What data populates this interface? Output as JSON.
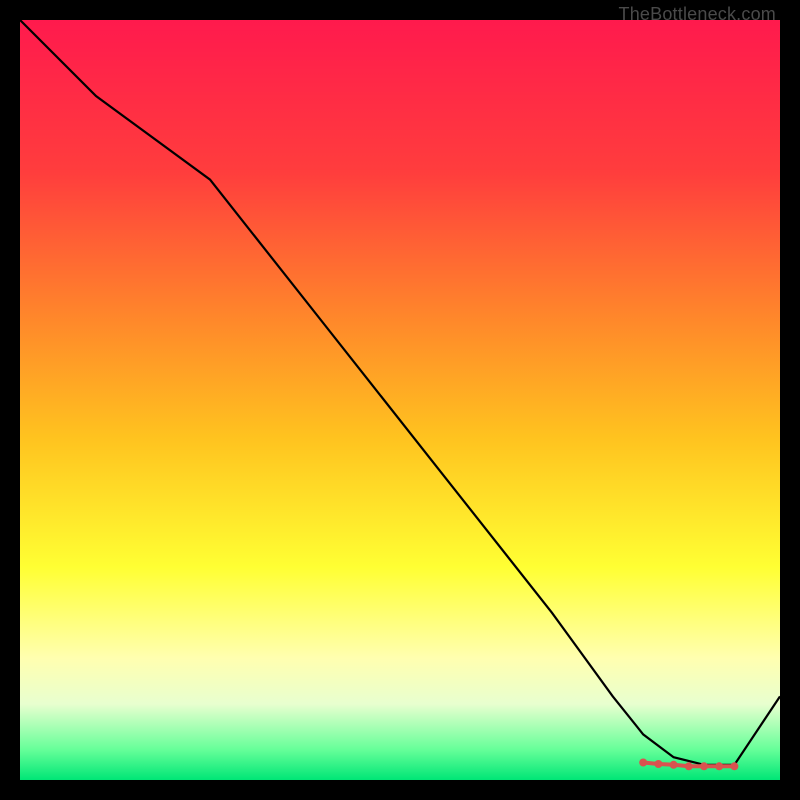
{
  "attribution": "TheBottleneck.com",
  "chart_data": {
    "type": "line",
    "title": "",
    "xlabel": "",
    "ylabel": "",
    "xlim": [
      0,
      100
    ],
    "ylim": [
      0,
      100
    ],
    "gradient_stops": [
      {
        "offset": 0.0,
        "color": "#ff1a4d"
      },
      {
        "offset": 0.2,
        "color": "#ff3d3d"
      },
      {
        "offset": 0.4,
        "color": "#ff8a2a"
      },
      {
        "offset": 0.55,
        "color": "#ffc31f"
      },
      {
        "offset": 0.72,
        "color": "#ffff33"
      },
      {
        "offset": 0.84,
        "color": "#ffffb0"
      },
      {
        "offset": 0.9,
        "color": "#e8ffcf"
      },
      {
        "offset": 0.96,
        "color": "#66ff99"
      },
      {
        "offset": 1.0,
        "color": "#00e676"
      }
    ],
    "series": [
      {
        "name": "bottleneck-curve",
        "x": [
          0,
          10,
          25,
          40,
          55,
          70,
          78,
          82,
          86,
          90,
          94,
          100
        ],
        "y": [
          100,
          90,
          79,
          60,
          41,
          22,
          11,
          6,
          3,
          2,
          2,
          11
        ]
      }
    ],
    "markers": {
      "name": "optimal-zone",
      "color": "#d9534f",
      "points": [
        {
          "x": 82,
          "y": 2.3
        },
        {
          "x": 84,
          "y": 2.1
        },
        {
          "x": 86,
          "y": 2.0
        },
        {
          "x": 88,
          "y": 1.8
        },
        {
          "x": 90,
          "y": 1.8
        },
        {
          "x": 92,
          "y": 1.8
        },
        {
          "x": 94,
          "y": 1.8
        }
      ]
    }
  }
}
